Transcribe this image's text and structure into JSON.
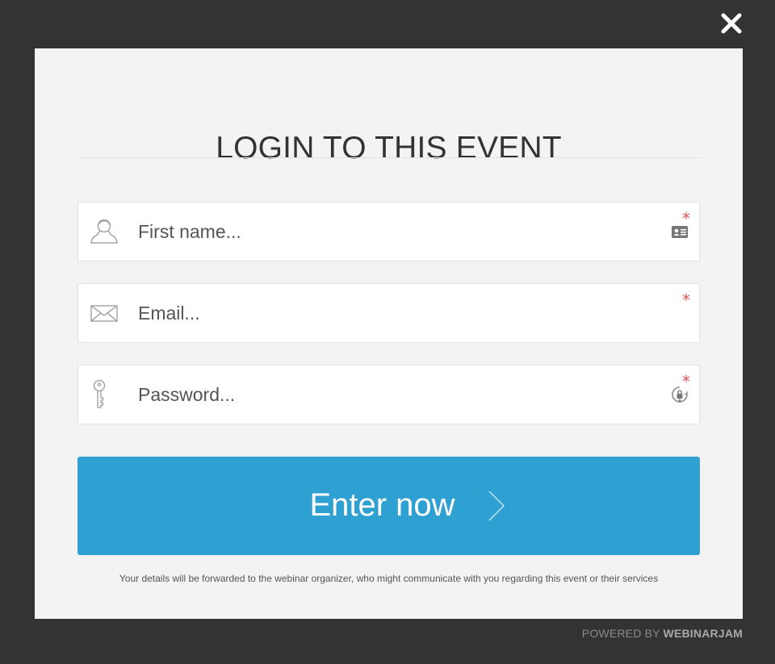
{
  "modal": {
    "title": "LOGIN TO THIS EVENT",
    "close_icon": "close-icon"
  },
  "form": {
    "first_name": {
      "placeholder": "First name...",
      "value": "",
      "icon": "user-icon",
      "required_mark": "*",
      "trailing_icon": "id-card-icon"
    },
    "email": {
      "placeholder": "Email...",
      "value": "",
      "icon": "envelope-icon",
      "required_mark": "*"
    },
    "password": {
      "placeholder": "Password...",
      "value": "",
      "icon": "key-icon",
      "required_mark": "*",
      "trailing_icon": "lock-icon"
    },
    "submit_label": "Enter now",
    "submit_icon": "chevron-right-icon"
  },
  "disclaimer": "Your details will be forwarded to the webinar organizer, who might communicate with you regarding this event or their services",
  "footer": {
    "powered_prefix": "POWERED BY",
    "brand": "WEBINARJAM"
  },
  "colors": {
    "overlay": "#333333",
    "modal_bg": "#f3f3f3",
    "accent": "#2ea0d2",
    "required": "#e05555"
  }
}
